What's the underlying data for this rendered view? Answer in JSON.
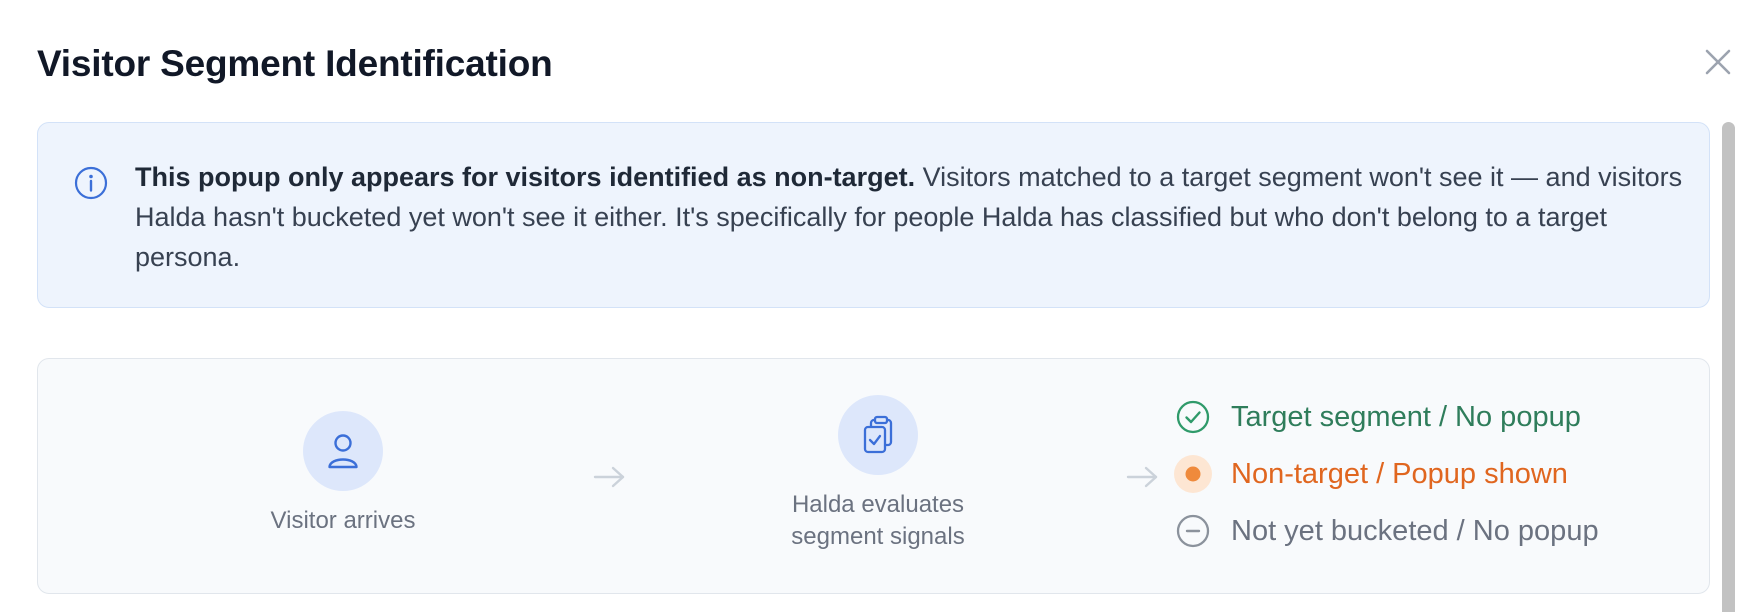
{
  "modal": {
    "title": "Visitor Segment Identification",
    "close_icon": "close-icon"
  },
  "info": {
    "icon": "info-icon",
    "bold_text": "This popup only appears for visitors identified as non-target.",
    "body_text": " Visitors matched to a target segment won't see it — and visitors Halda hasn't bucketed yet won't see it either. It's specifically for people Halda has classified but who don't belong to a target persona."
  },
  "flow": {
    "step1": {
      "icon": "user-icon",
      "label": "Visitor arrives"
    },
    "step2": {
      "icon": "clipboard-check-icon",
      "label_line1": "Halda evaluates",
      "label_line2": "segment signals"
    },
    "outcomes": [
      {
        "icon": "check-circle-icon",
        "label": "Target segment / No popup",
        "color": "#2f7d5b"
      },
      {
        "icon": "dot-icon",
        "label": "Non-target / Popup shown",
        "color": "#e0661f"
      },
      {
        "icon": "minus-circle-icon",
        "label": "Not yet bucketed / No popup",
        "color": "#6b7280"
      }
    ]
  },
  "colors": {
    "accent_blue": "#3b6fd8",
    "info_bg": "#eef4fd",
    "target_green": "#2f7d5b",
    "nontarget_orange": "#e0661f",
    "muted_gray": "#6b7280"
  }
}
